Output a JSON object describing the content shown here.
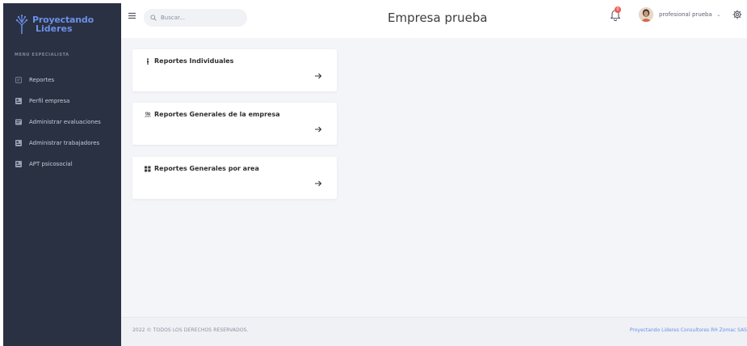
{
  "brand": {
    "line1": "Proyectando",
    "line2": "Lideres",
    "accent": "#6c8fe8"
  },
  "sidebar": {
    "section_title": "MENU ESPECIALISTA",
    "items": [
      {
        "label": "Reportes",
        "icon": "document-icon"
      },
      {
        "label": "Perfil empresa",
        "icon": "id-card-icon"
      },
      {
        "label": "Administrar evaluaciones",
        "icon": "clipboard-icon"
      },
      {
        "label": "Administrar trabajadores",
        "icon": "id-card-icon"
      },
      {
        "label": "APT psicosocial",
        "icon": "id-card-icon"
      }
    ],
    "background": "#2a3142"
  },
  "header": {
    "search_placeholder": "Buscar...",
    "title": "Empresa prueba",
    "notifications_count": "0",
    "user_name": "profesional prueba",
    "caret": "⌄"
  },
  "cards": [
    {
      "title": "Reportes Individuales",
      "icon": "person-icon"
    },
    {
      "title": "Reportes Generales de la empresa",
      "icon": "people-icon"
    },
    {
      "title": "Reportes Generales por area",
      "icon": "grid-icon"
    }
  ],
  "footer": {
    "left": "2022 © TODOS LOS DERECHOS RESERVADOS.",
    "right": "Proyectando Lideres Consultores RH Zomac SAS"
  }
}
